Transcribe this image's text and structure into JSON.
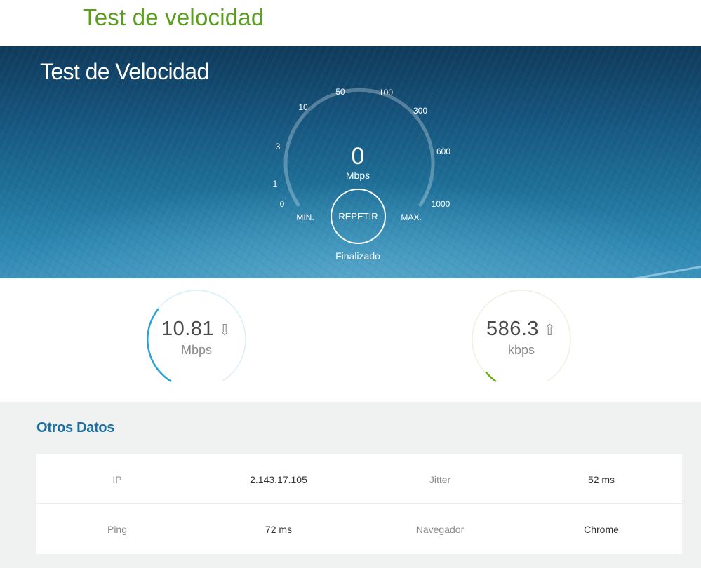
{
  "page": {
    "title": "Test de velocidad"
  },
  "hero": {
    "title": "Test de Velocidad",
    "gauge": {
      "ticks": [
        "0",
        "1",
        "3",
        "10",
        "50",
        "100",
        "300",
        "600",
        "1000"
      ],
      "min_label": "MIN.",
      "max_label": "MAX.",
      "value": "0",
      "unit": "Mbps"
    },
    "repeat_button": "REPETIR",
    "status": "Finalizado"
  },
  "results": {
    "download": {
      "value": "10.81",
      "unit": "Mbps",
      "arrow": "⇩",
      "color": "#2aa3d6"
    },
    "upload": {
      "value": "586.3",
      "unit": "kbps",
      "arrow": "⇧",
      "color": "#6aae1c"
    }
  },
  "other": {
    "title": "Otros Datos",
    "rows": [
      [
        {
          "label": "IP",
          "value": "2.143.17.105"
        },
        {
          "label": "Jitter",
          "value": "52 ms"
        }
      ],
      [
        {
          "label": "Ping",
          "value": "72 ms"
        },
        {
          "label": "Navegador",
          "value": "Chrome"
        }
      ]
    ]
  }
}
